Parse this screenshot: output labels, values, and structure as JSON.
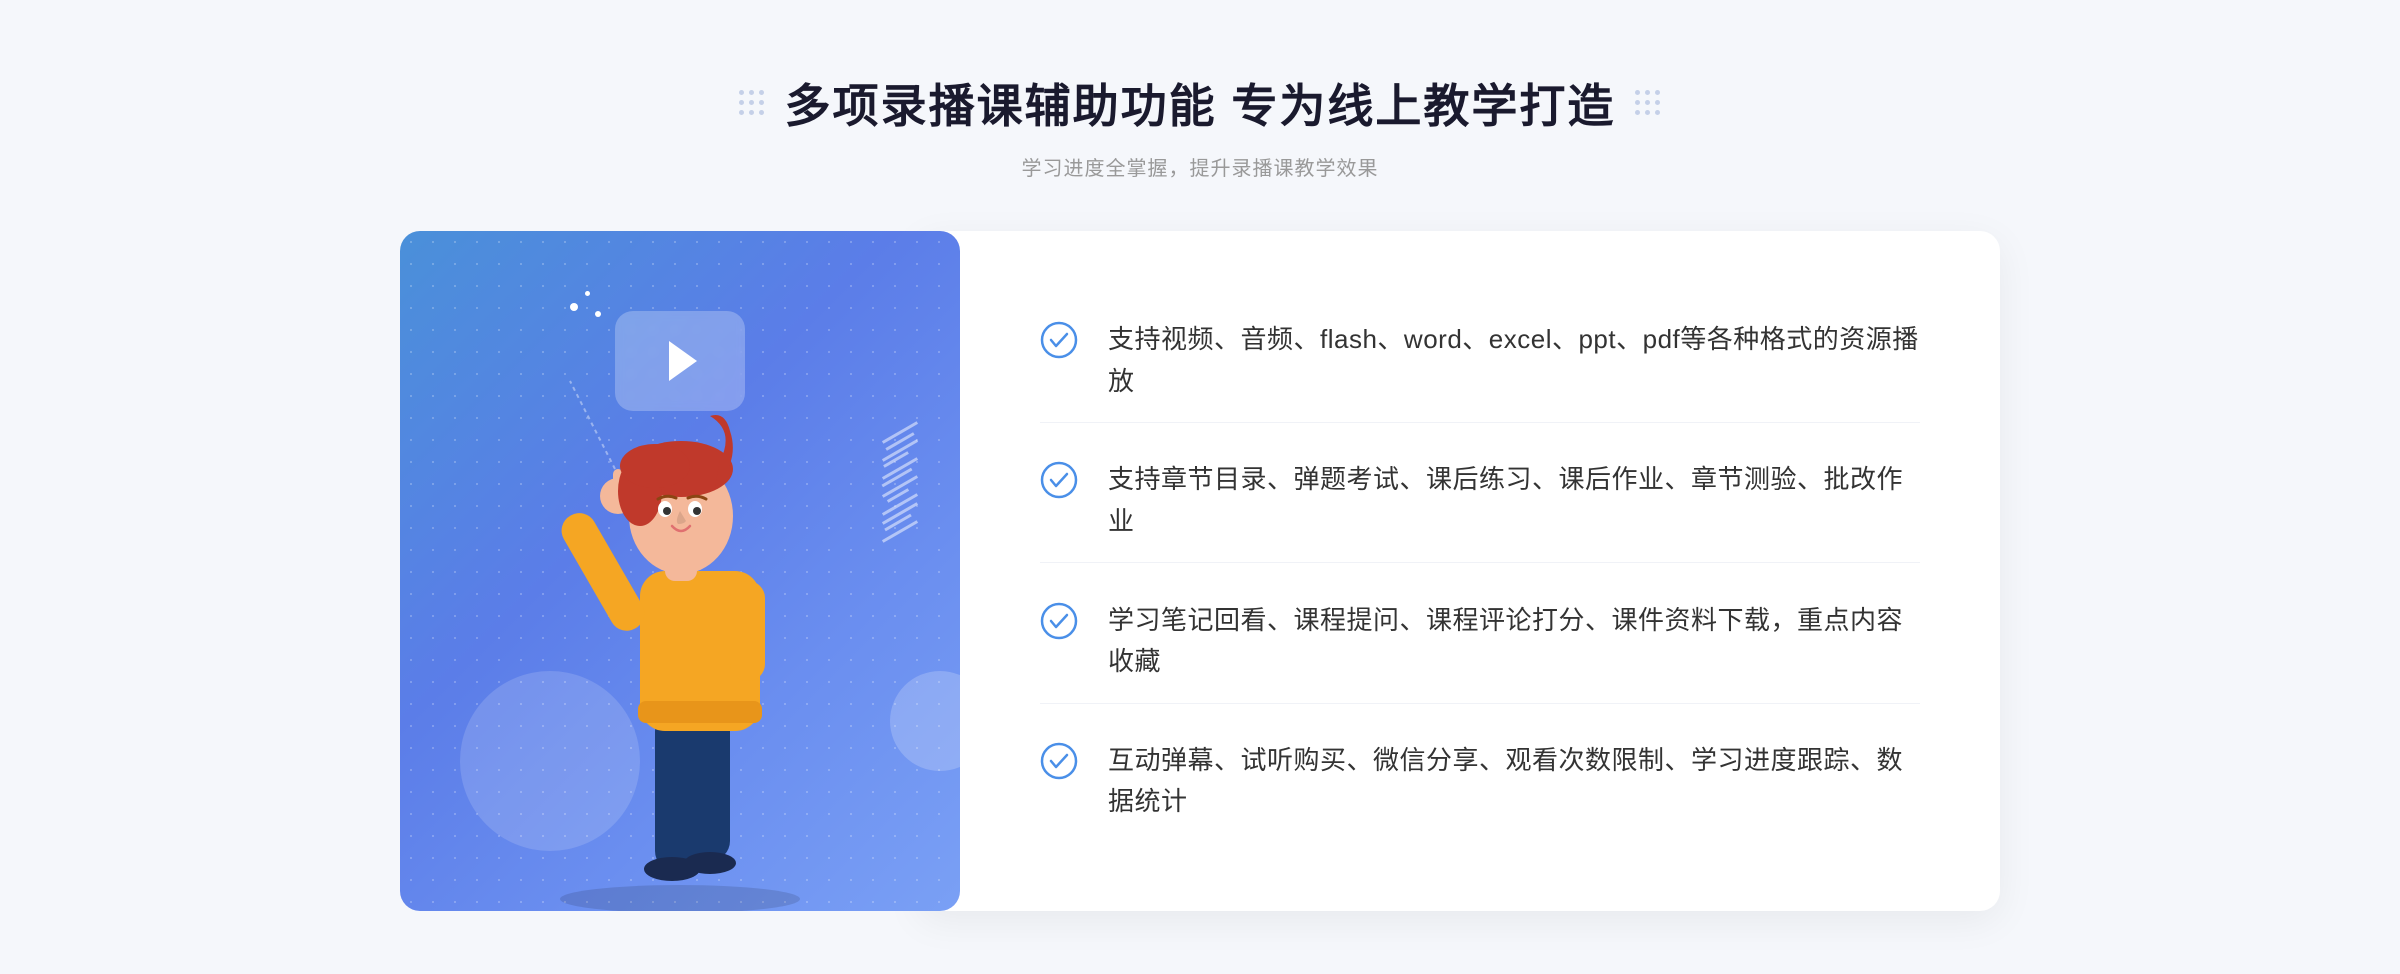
{
  "header": {
    "title": "多项录播课辅助功能 专为线上教学打造",
    "subtitle": "学习进度全掌握，提升录播课教学效果"
  },
  "features": [
    {
      "id": "feature-1",
      "text": "支持视频、音频、flash、word、excel、ppt、pdf等各种格式的资源播放"
    },
    {
      "id": "feature-2",
      "text": "支持章节目录、弹题考试、课后练习、课后作业、章节测验、批改作业"
    },
    {
      "id": "feature-3",
      "text": "学习笔记回看、课程提问、课程评论打分、课件资料下载，重点内容收藏"
    },
    {
      "id": "feature-4",
      "text": "互动弹幕、试听购买、微信分享、观看次数限制、学习进度跟踪、数据统计"
    }
  ],
  "decorative": {
    "left_chevrons": "»",
    "colors": {
      "primary_blue": "#4a8fe8",
      "light_blue": "#7ab3f5",
      "card_gradient_start": "#4a90d9",
      "card_gradient_end": "#7aa0f5",
      "check_color": "#4a8fe8"
    }
  }
}
